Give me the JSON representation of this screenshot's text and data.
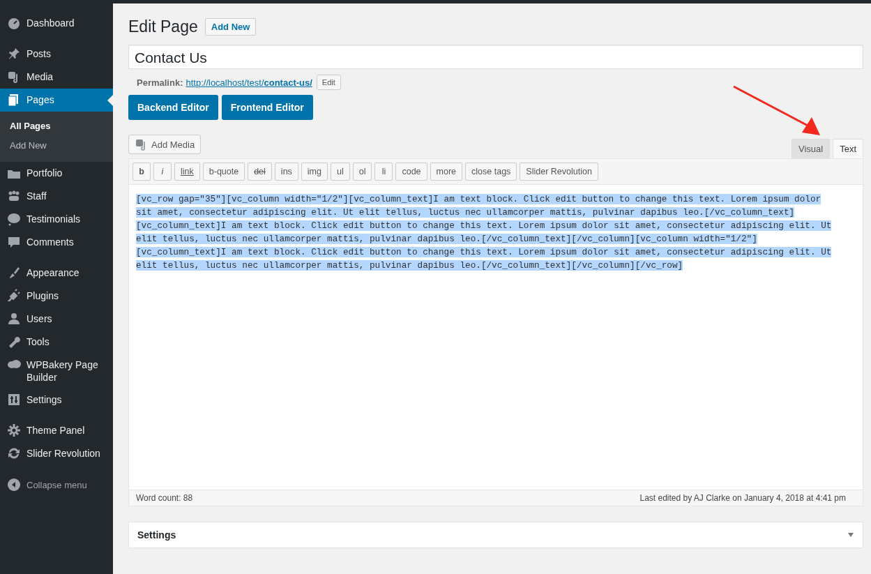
{
  "sidebar": {
    "groups": [
      [
        {
          "label": "Dashboard",
          "selected": false
        }
      ],
      [
        {
          "label": "Posts",
          "selected": false
        },
        {
          "label": "Media",
          "selected": false
        },
        {
          "label": "Pages",
          "selected": true,
          "submenu": [
            {
              "label": "All Pages",
              "selected": true
            },
            {
              "label": "Add New",
              "selected": false
            }
          ]
        },
        {
          "label": "Portfolio",
          "selected": false
        },
        {
          "label": "Staff",
          "selected": false
        },
        {
          "label": "Testimonials",
          "selected": false
        },
        {
          "label": "Comments",
          "selected": false
        }
      ],
      [
        {
          "label": "Appearance",
          "selected": false
        },
        {
          "label": "Plugins",
          "selected": false
        },
        {
          "label": "Users",
          "selected": false
        },
        {
          "label": "Tools",
          "selected": false
        },
        {
          "label": "WPBakery Page Builder",
          "selected": false
        },
        {
          "label": "Settings",
          "selected": false
        }
      ],
      [
        {
          "label": "Theme Panel",
          "selected": false
        },
        {
          "label": "Slider Revolution",
          "selected": false
        }
      ]
    ],
    "collapse": "Collapse menu"
  },
  "page": {
    "heading": "Edit Page",
    "add_new": "Add New",
    "title_value": "Contact Us",
    "permalink": {
      "label": "Permalink:",
      "url_base": "http://localhost/test/",
      "url_slug": "contact-us/",
      "edit": "Edit"
    },
    "editor_buttons": [
      "Backend Editor",
      "Frontend Editor"
    ],
    "add_media": "Add Media",
    "tabs": [
      {
        "label": "Visual",
        "selected": false
      },
      {
        "label": "Text",
        "selected": true
      }
    ],
    "quicktags": [
      "b",
      "i",
      "link",
      "b-quote",
      "del",
      "ins",
      "img",
      "ul",
      "ol",
      "li",
      "code",
      "more",
      "close tags",
      "Slider Revolution"
    ],
    "content_lines": [
      "[vc_row gap=\"35\"][vc_column width=\"1/2\"][vc_column_text]I am text block. Click edit button to change this text. Lorem ipsum dolor",
      "sit amet, consectetur adipiscing elit. Ut elit tellus, luctus nec ullamcorper mattis, pulvinar dapibus leo.[/vc_column_text]",
      "[vc_column_text]I am text block. Click edit button to change this text. Lorem ipsum dolor sit amet, consectetur adipiscing elit. Ut",
      "elit tellus, luctus nec ullamcorper mattis, pulvinar dapibus leo.[/vc_column_text][/vc_column][vc_column width=\"1/2\"]",
      "[vc_column_text]I am text block. Click edit button to change this text. Lorem ipsum dolor sit amet, consectetur adipiscing elit. Ut",
      "elit tellus, luctus nec ullamcorper mattis, pulvinar dapibus leo.[/vc_column_text][/vc_column][/vc_row]"
    ],
    "content_selected": true,
    "word_count": "Word count: 88",
    "last_edited": "Last edited by AJ Clarke on January 4, 2018 at 4:41 pm",
    "settings_box": {
      "title": "Settings",
      "expanded": false
    }
  }
}
